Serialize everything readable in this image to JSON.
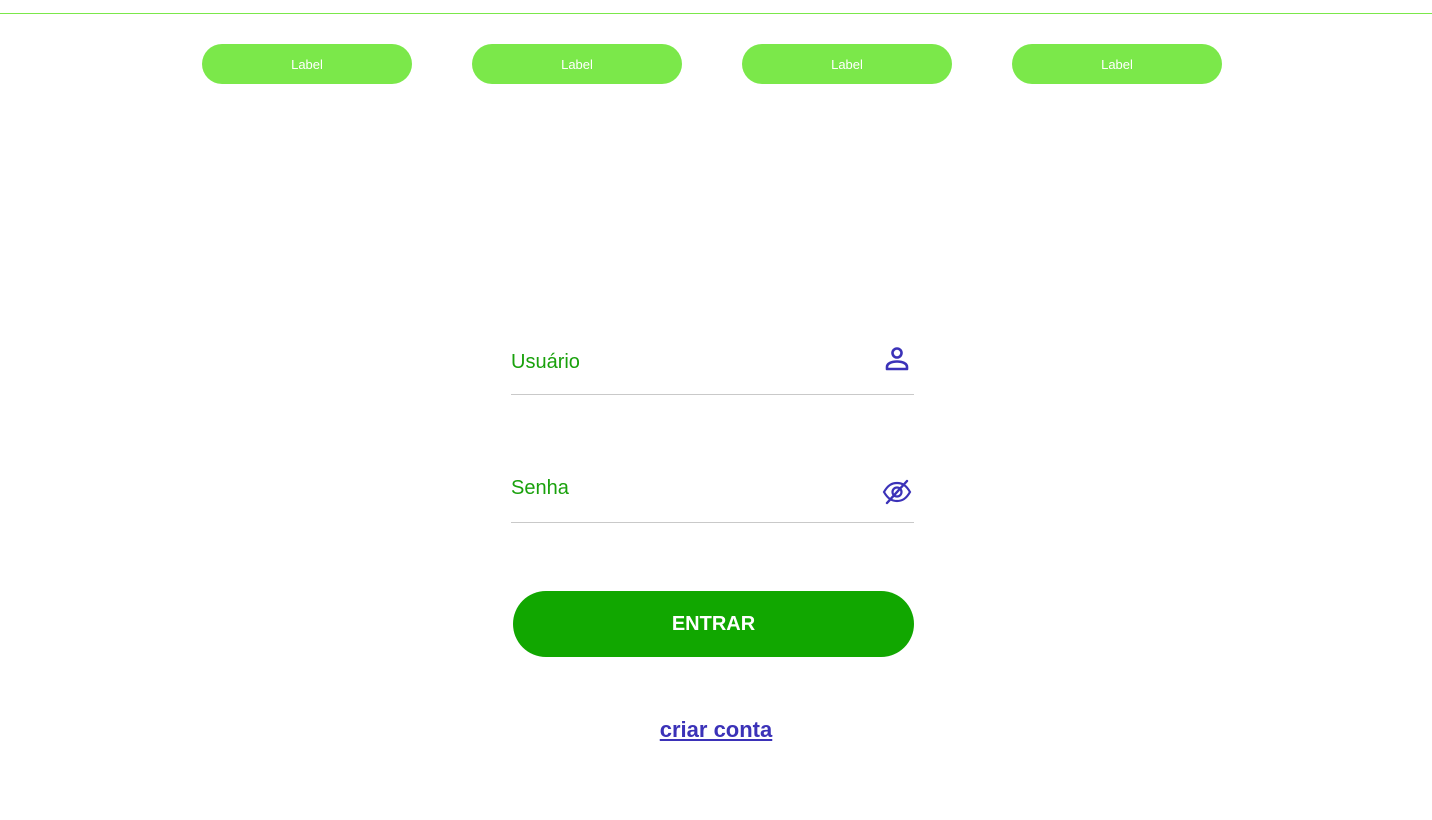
{
  "nav": {
    "items": [
      {
        "label": "Label"
      },
      {
        "label": "Label"
      },
      {
        "label": "Label"
      },
      {
        "label": "Label"
      }
    ]
  },
  "login": {
    "username_label": "Usuário",
    "username_icon": "user-icon",
    "password_label": "Senha",
    "password_icon": "eye-off-icon",
    "submit_label": "ENTRAR",
    "create_account_label": "criar conta"
  },
  "colors": {
    "nav_pill": "#7be84a",
    "field_label": "#19a10c",
    "primary_button": "#11a700",
    "icon_and_link": "#3b32b8"
  }
}
